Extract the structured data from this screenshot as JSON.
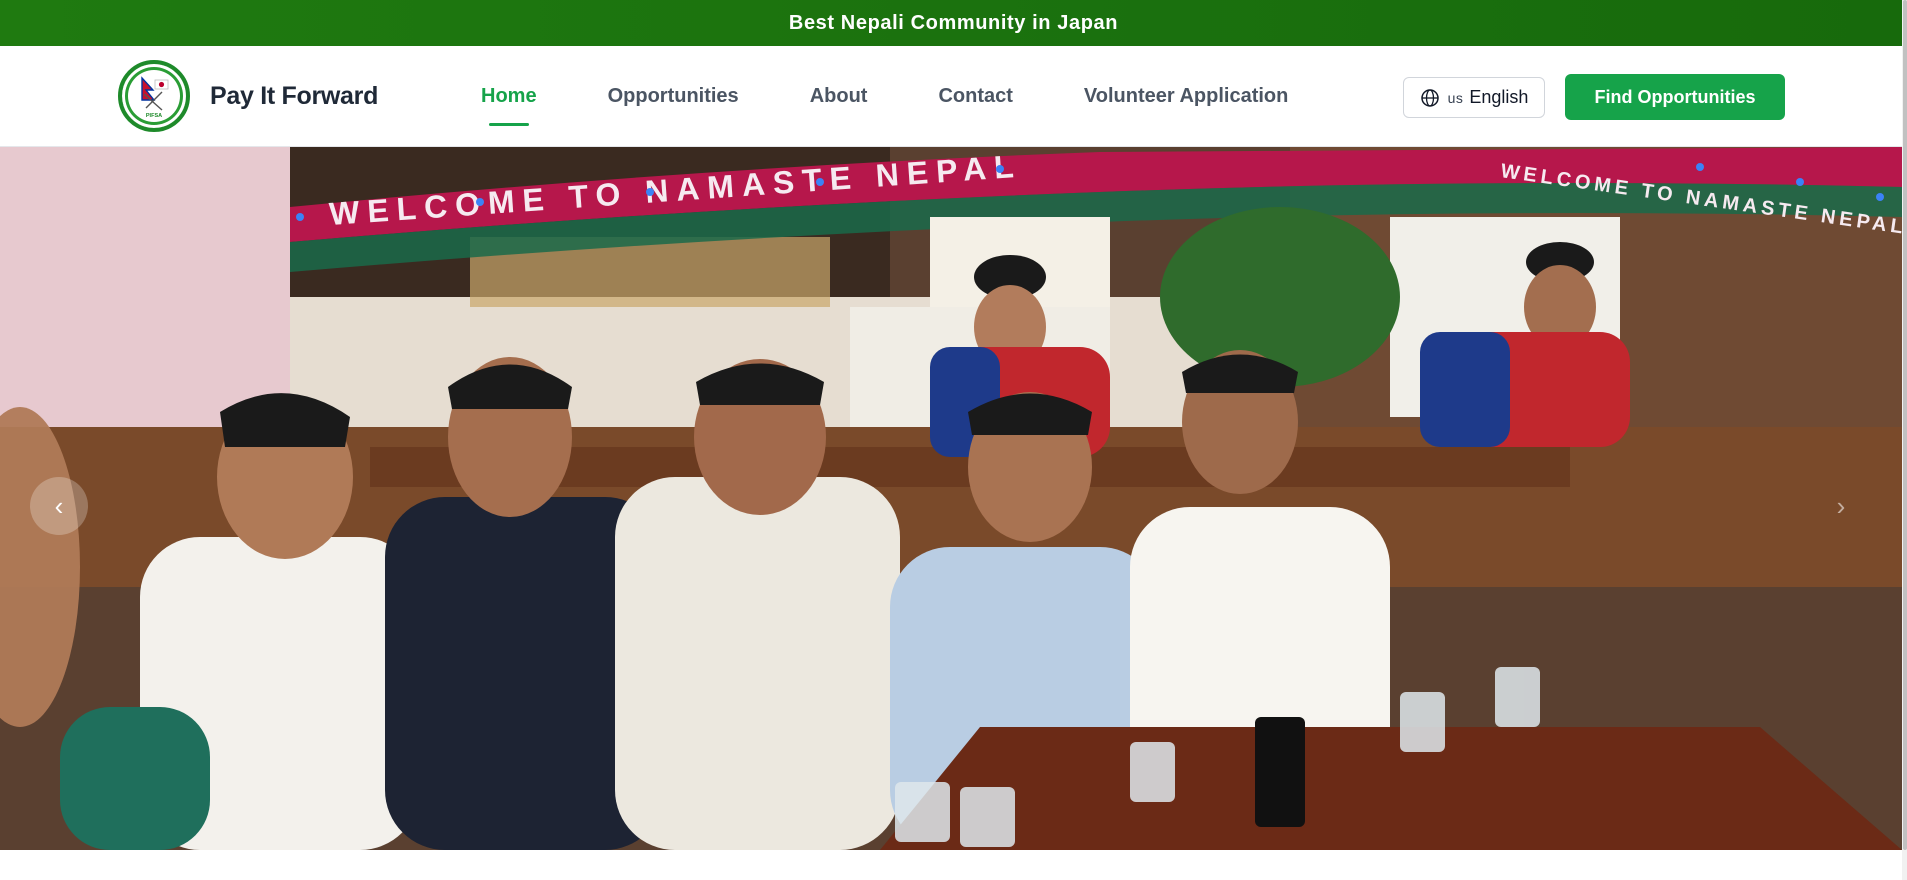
{
  "announcement": {
    "text": "Best Nepali Community in Japan"
  },
  "brand": {
    "name": "Pay It Forward",
    "logo_icon": "nepal-japan-flags-logo-icon",
    "logo_text": "PIFSA"
  },
  "nav": {
    "items": [
      {
        "label": "Home",
        "active": true
      },
      {
        "label": "Opportunities",
        "active": false
      },
      {
        "label": "About",
        "active": false
      },
      {
        "label": "Contact",
        "active": false
      },
      {
        "label": "Volunteer Application",
        "active": false
      }
    ]
  },
  "language": {
    "code": "us",
    "label": "English",
    "icon": "globe-icon"
  },
  "cta": {
    "label": "Find Opportunities"
  },
  "hero": {
    "banner_text": "WELCOME TO NAMASTE NEPAL",
    "banner_text_right": "WELCOME TO NAMASTE NEPAL",
    "prev_icon": "chevron-left-icon",
    "next_icon": "chevron-right-icon"
  },
  "colors": {
    "brand_green": "#16a34a",
    "announce_green": "#1f7a10",
    "text_dark": "#1f2937",
    "nav_text": "#4b5563"
  }
}
